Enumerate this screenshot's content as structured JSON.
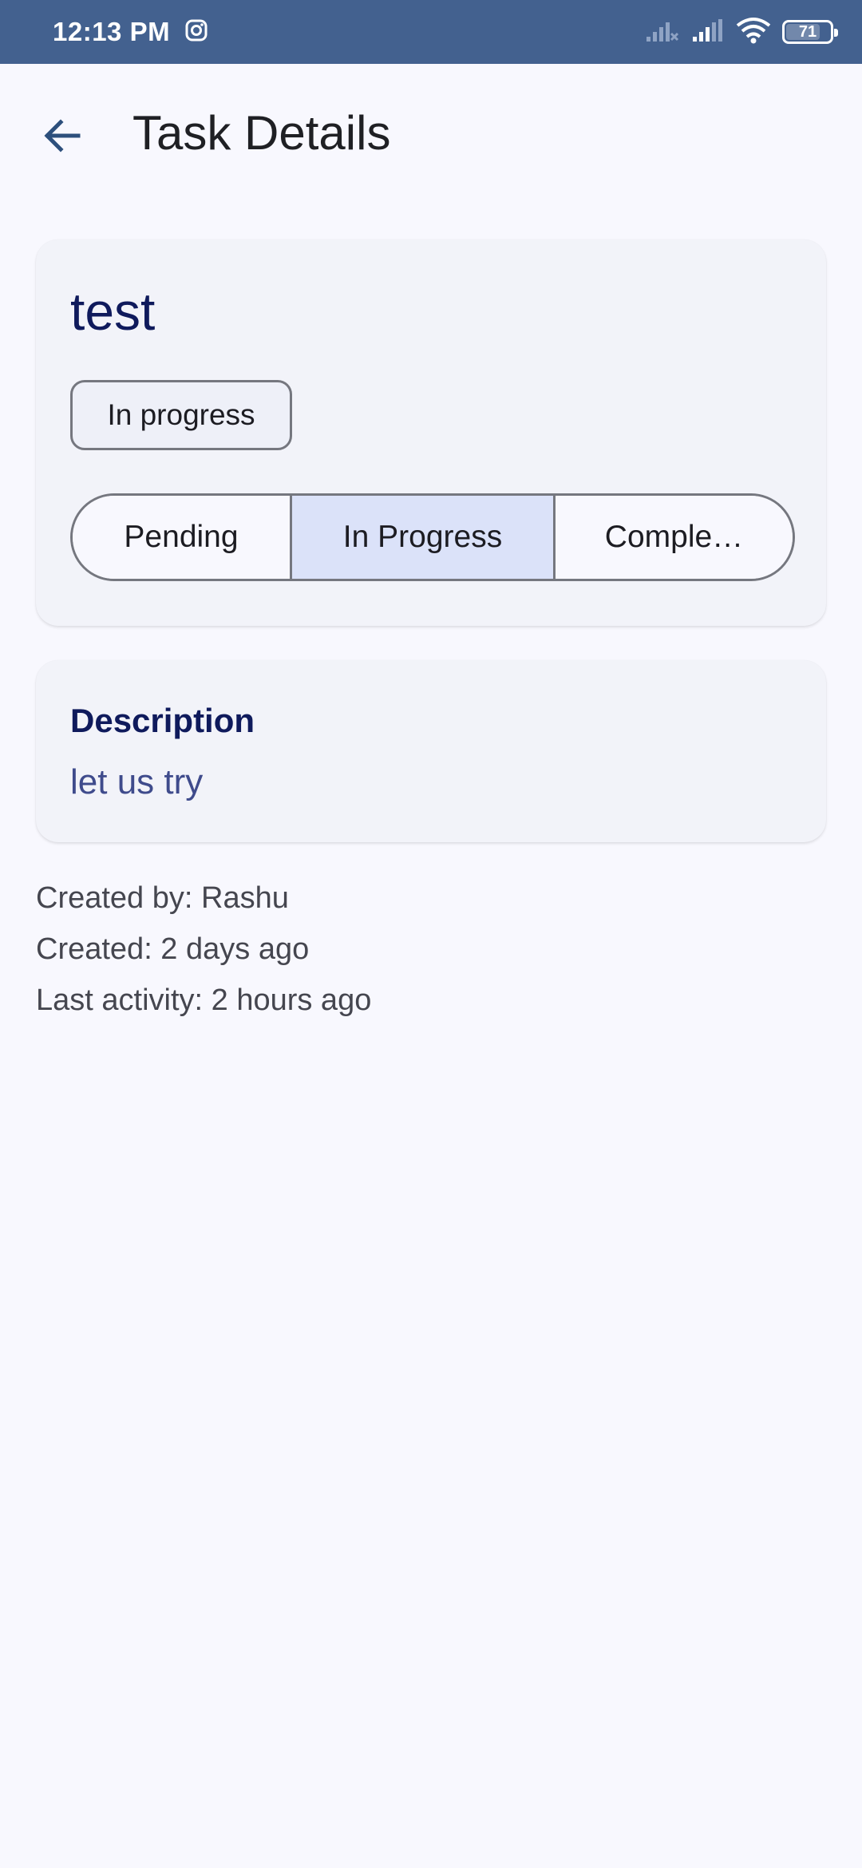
{
  "status_bar": {
    "time": "12:13 PM",
    "battery": "71",
    "icons": [
      "instagram-icon",
      "signal-off-icon",
      "signal-icon",
      "wifi-icon",
      "battery-icon"
    ]
  },
  "app_bar": {
    "title": "Task Details",
    "back_icon": "arrow-back-icon"
  },
  "task": {
    "title": "test",
    "status_chip": "In progress",
    "status_options": [
      "Pending",
      "In Progress",
      "Comple…"
    ],
    "selected_status": "In Progress"
  },
  "description": {
    "label": "Description",
    "text": "let us try"
  },
  "meta": {
    "created_by": "Created by: Rashu",
    "created": "Created: 2 days ago",
    "last_activity": "Last activity: 2 hours ago"
  },
  "colors": {
    "status_bar": "#43618f",
    "background": "#f8f8fe",
    "card": "#f2f3f9",
    "selected_segment": "#dbe2f9",
    "title_text": "#0f1a5c"
  }
}
